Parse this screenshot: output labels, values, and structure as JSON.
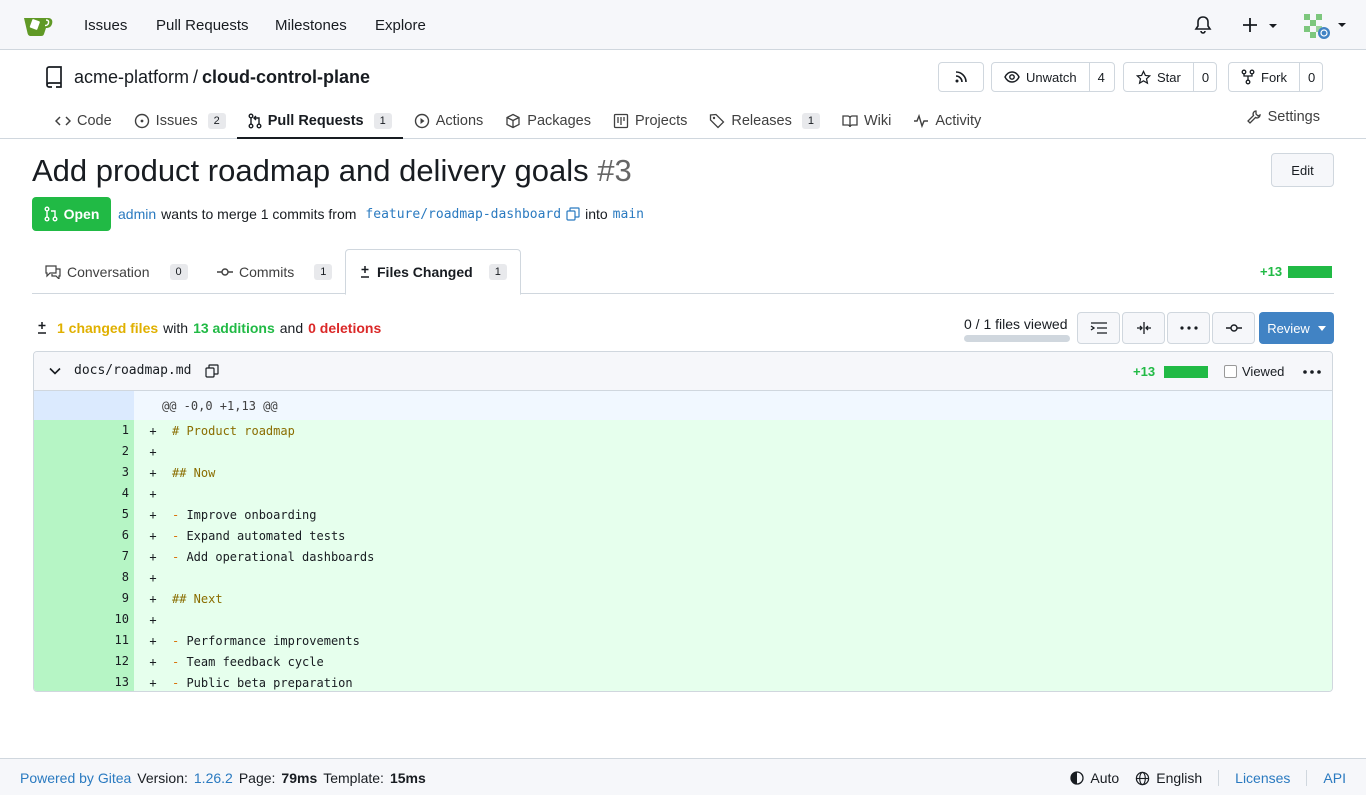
{
  "nav": {
    "links": [
      "Issues",
      "Pull Requests",
      "Milestones",
      "Explore"
    ]
  },
  "repo": {
    "owner": "acme-platform",
    "separator": "/",
    "name": "cloud-control-plane",
    "buttons": {
      "unwatch_label": "Unwatch",
      "watch_count": "4",
      "star_label": "Star",
      "star_count": "0",
      "fork_label": "Fork",
      "fork_count": "0"
    },
    "tabs": [
      {
        "label": "Code",
        "icon": "code-icon"
      },
      {
        "label": "Issues",
        "icon": "issue-icon",
        "count": "2"
      },
      {
        "label": "Pull Requests",
        "icon": "pull-request-icon",
        "count": "1"
      },
      {
        "label": "Actions",
        "icon": "play-icon"
      },
      {
        "label": "Packages",
        "icon": "package-icon"
      },
      {
        "label": "Projects",
        "icon": "project-icon"
      },
      {
        "label": "Releases",
        "icon": "tag-icon",
        "count": "1"
      },
      {
        "label": "Wiki",
        "icon": "book-icon"
      },
      {
        "label": "Activity",
        "icon": "pulse-icon"
      }
    ],
    "settings": "Settings"
  },
  "pr": {
    "title": "Add product roadmap and delivery goals",
    "number": "#3",
    "edit": "Edit",
    "state": "Open",
    "author": "admin",
    "merge_text": "wants to merge 1 commits from",
    "head_branch": "feature/roadmap-dashboard",
    "into": "into",
    "base_branch": "main",
    "tabs": {
      "conversation": "Conversation",
      "conversation_count": "0",
      "commits": "Commits",
      "commits_count": "1",
      "files": "Files Changed",
      "files_count": "1"
    },
    "diffstat": "+13"
  },
  "summary": {
    "changed_files": "1 changed files",
    "with": "with",
    "additions": "13 additions",
    "and": "and",
    "deletions": "0 deletions",
    "viewed": "0 / 1 files viewed",
    "viewed_fraction": 0,
    "review": "Review"
  },
  "file": {
    "name": "docs/roadmap.md",
    "additions": "+13",
    "viewed_label": "Viewed",
    "hunk": "@@ -0,0 +1,13 @@",
    "lines": [
      {
        "n": "1",
        "text": "# Product roadmap"
      },
      {
        "n": "2",
        "text": ""
      },
      {
        "n": "3",
        "text": "## Now"
      },
      {
        "n": "4",
        "text": ""
      },
      {
        "n": "5",
        "text": "- Improve onboarding"
      },
      {
        "n": "6",
        "text": "- Expand automated tests"
      },
      {
        "n": "7",
        "text": "- Add operational dashboards"
      },
      {
        "n": "8",
        "text": ""
      },
      {
        "n": "9",
        "text": "## Next"
      },
      {
        "n": "10",
        "text": ""
      },
      {
        "n": "11",
        "text": "- Performance improvements"
      },
      {
        "n": "12",
        "text": "- Team feedback cycle"
      },
      {
        "n": "13",
        "text": "- Public beta preparation"
      }
    ]
  },
  "footer": {
    "powered": "Powered by Gitea",
    "version_label": "Version:",
    "version": "1.26.2",
    "page_label": "Page:",
    "page_time": "79ms",
    "template_label": "Template:",
    "template_time": "15ms",
    "theme": "Auto",
    "language": "English",
    "licenses": "Licenses",
    "api": "API"
  },
  "colors": {
    "accent": "#2a7ac0",
    "success": "#21ba45",
    "danger": "#db2828",
    "added_bg": "#e6ffed"
  }
}
